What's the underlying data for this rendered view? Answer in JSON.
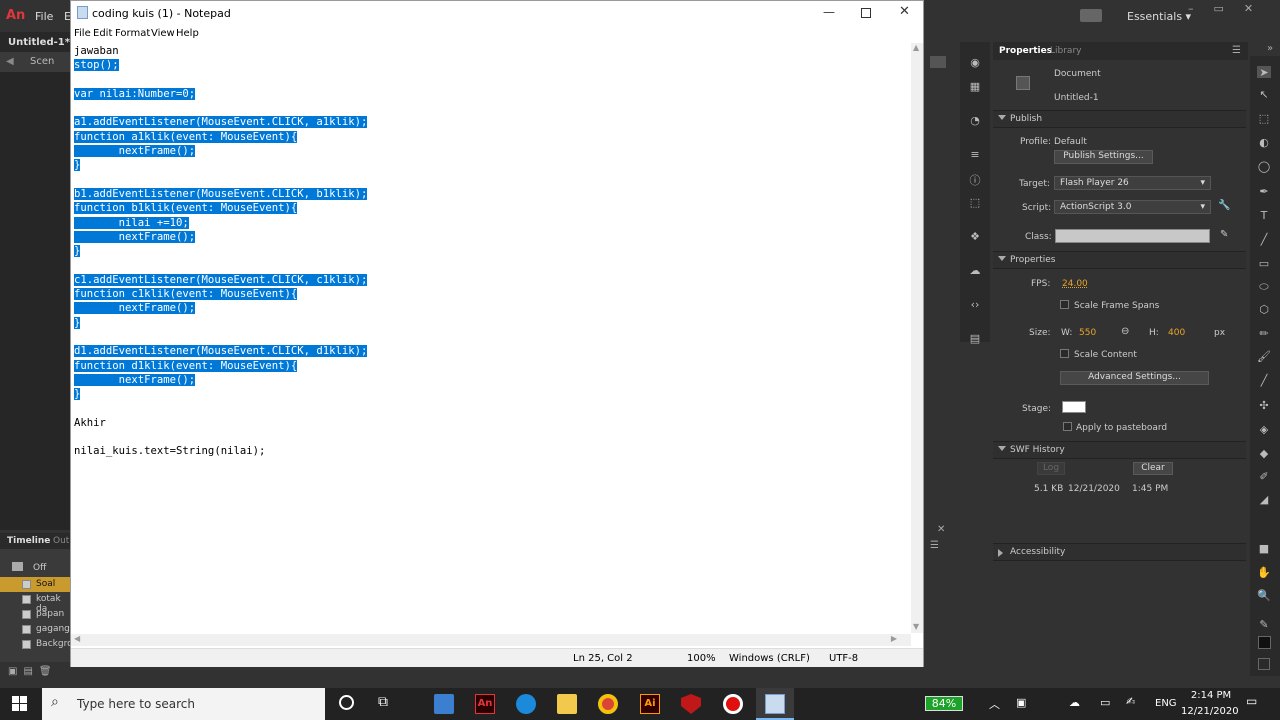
{
  "animate": {
    "logo": "An",
    "menu_file": "File",
    "menu_e": "E",
    "essentials": "Essentials",
    "tab_title": "Untitled-1*",
    "scene": "Scen"
  },
  "notepad": {
    "title": "coding kuis (1) - Notepad",
    "menu": [
      "File",
      "Edit",
      "Format",
      "View",
      "Help"
    ],
    "lines": [
      {
        "text": "jawaban",
        "hl": false
      },
      {
        "text": "stop();",
        "hl": true
      },
      {
        "text": "",
        "hl": false
      },
      {
        "text": "var nilai:Number=0;",
        "hl": true
      },
      {
        "text": "",
        "hl": false
      },
      {
        "text": "a1.addEventListener(MouseEvent.CLICK, a1klik);",
        "hl": true
      },
      {
        "text": "function a1klik(event: MouseEvent){",
        "hl": true
      },
      {
        "text": "       nextFrame();",
        "hl": true
      },
      {
        "text": "}",
        "hl": true
      },
      {
        "text": "",
        "hl": false
      },
      {
        "text": "b1.addEventListener(MouseEvent.CLICK, b1klik);",
        "hl": true
      },
      {
        "text": "function b1klik(event: MouseEvent){",
        "hl": true
      },
      {
        "text": "       nilai +=10;",
        "hl": true
      },
      {
        "text": "       nextFrame();",
        "hl": true
      },
      {
        "text": "}",
        "hl": true
      },
      {
        "text": "",
        "hl": false
      },
      {
        "text": "c1.addEventListener(MouseEvent.CLICK, c1klik);",
        "hl": true
      },
      {
        "text": "function c1klik(event: MouseEvent){",
        "hl": true
      },
      {
        "text": "       nextFrame();",
        "hl": true
      },
      {
        "text": "}",
        "hl": true
      },
      {
        "text": "",
        "hl": false
      },
      {
        "text": "d1.addEventListener(MouseEvent.CLICK, d1klik);",
        "hl": true
      },
      {
        "text": "function d1klik(event: MouseEvent){",
        "hl": true
      },
      {
        "text": "       nextFrame();",
        "hl": true
      },
      {
        "text": "}",
        "hl": true
      },
      {
        "text": "",
        "hl": false
      },
      {
        "text": "Akhir",
        "hl": false
      },
      {
        "text": "",
        "hl": false
      },
      {
        "text": "nilai_kuis.text=String(nilai);",
        "hl": false
      }
    ],
    "status": {
      "position": "Ln 25, Col 2",
      "zoom": "100%",
      "line_ending": "Windows (CRLF)",
      "encoding": "UTF-8"
    }
  },
  "timeline": {
    "title": "Timeline",
    "output_tab": "Outp",
    "off": "Off",
    "layers": [
      "Soal",
      "kotak da",
      "papan",
      "gagang",
      "Backgro"
    ]
  },
  "properties": {
    "tab_properties": "Properties",
    "tab_library": "Library",
    "document": "Document",
    "doc_name": "Untitled-1",
    "publish_section": "Publish",
    "profile_label": "Profile:",
    "profile_value": "Default",
    "publish_settings": "Publish Settings...",
    "target_label": "Target:",
    "target_value": "Flash Player 26",
    "script_label": "Script:",
    "script_value": "ActionScript 3.0",
    "class_label": "Class:",
    "properties_section": "Properties",
    "fps_label": "FPS:",
    "fps_value": "24.00",
    "scale_frame_spans": "Scale Frame Spans",
    "size_label": "Size:",
    "w_label": "W:",
    "w_value": "550",
    "h_label": "H:",
    "h_value": "400",
    "unit": "px",
    "scale_content": "Scale Content",
    "advanced_settings": "Advanced Settings...",
    "stage_label": "Stage:",
    "apply_pasteboard": "Apply to pasteboard",
    "swf_section": "SWF History",
    "log": "Log",
    "clear": "Clear",
    "swf_size": "5.1 KB",
    "swf_date": "12/21/2020",
    "swf_time": "1:45 PM",
    "accessibility_section": "Accessibility"
  },
  "taskbar": {
    "search_placeholder": "Type here to search",
    "battery": "84%",
    "language": "ENG",
    "time": "2:14 PM",
    "date": "12/21/2020"
  }
}
